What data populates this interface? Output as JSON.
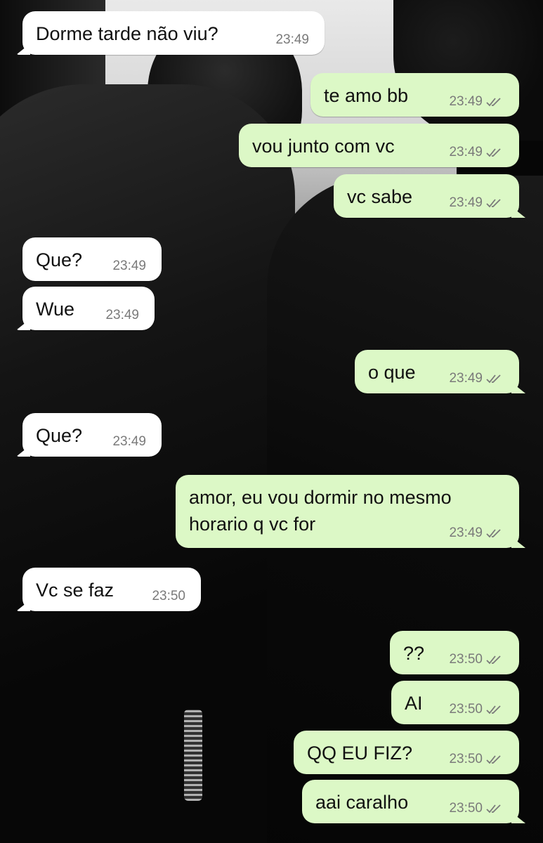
{
  "chat": {
    "messages": [
      {
        "direction": "incoming",
        "text": "Dorme tarde não viu?",
        "time": "23:49"
      },
      {
        "direction": "outgoing",
        "text": "te amo bb",
        "time": "23:49",
        "status_icon": "double-check-icon"
      },
      {
        "direction": "outgoing",
        "text": "vou junto com vc",
        "time": "23:49",
        "status_icon": "double-check-icon"
      },
      {
        "direction": "outgoing",
        "text": "vc sabe",
        "time": "23:49",
        "status_icon": "double-check-icon"
      },
      {
        "direction": "incoming",
        "text": "Que?",
        "time": "23:49"
      },
      {
        "direction": "incoming",
        "text": "Wue",
        "time": "23:49"
      },
      {
        "direction": "outgoing",
        "text": "o que",
        "time": "23:49",
        "status_icon": "double-check-icon"
      },
      {
        "direction": "incoming",
        "text": "Que?",
        "time": "23:49"
      },
      {
        "direction": "outgoing",
        "text": "amor, eu vou dormir no mesmo\nhorario q vc for",
        "time": "23:49",
        "status_icon": "double-check-icon"
      },
      {
        "direction": "incoming",
        "text": "Vc se faz",
        "time": "23:50"
      },
      {
        "direction": "outgoing",
        "text": "??",
        "time": "23:50",
        "status_icon": "double-check-icon"
      },
      {
        "direction": "outgoing",
        "text": "AI",
        "time": "23:50",
        "status_icon": "double-check-icon"
      },
      {
        "direction": "outgoing",
        "text": "QQ EU FIZ?",
        "time": "23:50",
        "status_icon": "double-check-icon"
      },
      {
        "direction": "outgoing",
        "text": "aai caralho",
        "time": "23:50",
        "status_icon": "double-check-icon"
      }
    ]
  },
  "colors": {
    "incoming_bubble": "#ffffff",
    "outgoing_bubble": "#dcf8c6",
    "timestamp": "#7a7a7a",
    "wallpaper": "#050505"
  },
  "wallpaper": {
    "icon": "dark-photo-wallpaper"
  }
}
